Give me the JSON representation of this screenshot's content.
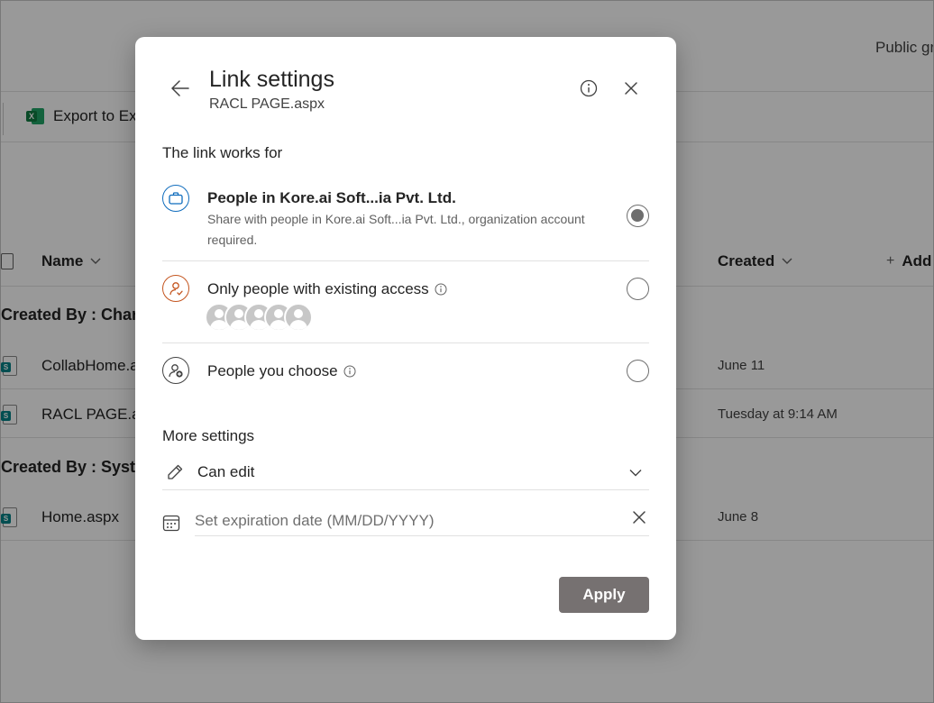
{
  "background": {
    "header_right_text": "Public gr",
    "toolbar": {
      "export_label": "Export to Ex"
    },
    "columns": {
      "name": "Name",
      "created": "Created",
      "add_column": "Add"
    },
    "groups": [
      {
        "label": "Created By : Char"
      },
      {
        "label": "Created By : Syste"
      }
    ],
    "rows": [
      {
        "name": "CollabHome.a",
        "created": "June 11"
      },
      {
        "name": "RACL PAGE.as",
        "created": "Tuesday at 9:14 AM"
      },
      {
        "name": "Home.aspx",
        "created": "June 8"
      }
    ]
  },
  "dialog": {
    "title": "Link settings",
    "subtitle": "RACL PAGE.aspx",
    "section_link_works_for": "The link works for",
    "options": [
      {
        "title": "People in Kore.ai Soft...ia Pvt. Ltd.",
        "description": "Share with people in Kore.ai Soft...ia Pvt. Ltd., organization account required.",
        "icon": "briefcase-icon",
        "selected": true
      },
      {
        "title": "Only people with existing access",
        "icon": "person-sync-icon",
        "selected": false,
        "avatar_count": 5
      },
      {
        "title": "People you choose",
        "icon": "person-add-icon",
        "selected": false
      }
    ],
    "section_more_settings": "More settings",
    "permission": {
      "label": "Can edit",
      "icon": "pencil-icon"
    },
    "expiration": {
      "placeholder": "Set expiration date (MM/DD/YYYY)",
      "value": ""
    },
    "apply_label": "Apply"
  },
  "colors": {
    "overlay": "rgba(0,0,0,0.4)",
    "apply_button": "#767171",
    "option_blue": "#0f6cbd",
    "option_orange": "#c4551f",
    "radio": "#6e6e6e"
  }
}
